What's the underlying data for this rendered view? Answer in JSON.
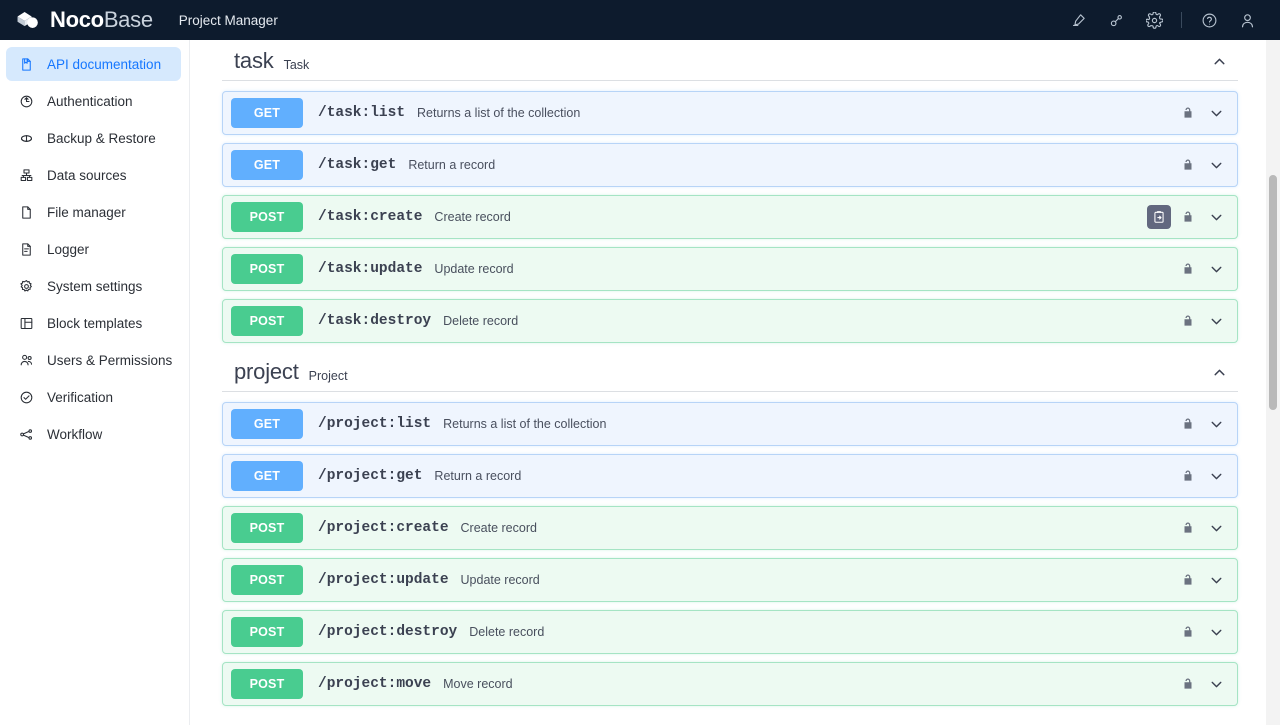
{
  "header": {
    "brand_primary": "Noco",
    "brand_secondary": "Base",
    "app_title": "Project Manager",
    "icons": [
      {
        "name": "highlighter-icon",
        "label": "Highlighter"
      },
      {
        "name": "plugin-icon",
        "label": "Plugin manager"
      },
      {
        "name": "gear-icon",
        "label": "Settings"
      },
      {
        "name": "help-circle-icon",
        "label": "Help"
      },
      {
        "name": "user-avatar-icon",
        "label": "Account"
      }
    ],
    "background_color": "#0d1b2d"
  },
  "sidebar": {
    "active_index": 0,
    "active_color": "#1677ff",
    "active_bg": "#d6e9fd",
    "items": [
      {
        "label": "API documentation",
        "icon": "api-doc-icon"
      },
      {
        "label": "Authentication",
        "icon": "authentication-icon"
      },
      {
        "label": "Backup & Restore",
        "icon": "backup-restore-icon"
      },
      {
        "label": "Data sources",
        "icon": "data-sources-icon"
      },
      {
        "label": "File manager",
        "icon": "file-manager-icon"
      },
      {
        "label": "Logger",
        "icon": "logger-icon"
      },
      {
        "label": "System settings",
        "icon": "system-settings-icon"
      },
      {
        "label": "Block templates",
        "icon": "block-templates-icon"
      },
      {
        "label": "Users & Permissions",
        "icon": "users-permissions-icon"
      },
      {
        "label": "Verification",
        "icon": "verification-icon"
      },
      {
        "label": "Workflow",
        "icon": "workflow-icon"
      }
    ]
  },
  "main": {
    "verb_colors": {
      "GET": "#61affe",
      "POST": "#49cc90"
    },
    "sections": [
      {
        "name": "task",
        "title": "Task",
        "collapsed": false,
        "toggle_icon": "chevron-up-icon",
        "operations": [
          {
            "verb": "GET",
            "path": "/task:list",
            "desc": "Returns a list of the collection",
            "lock": "unlocked-icon",
            "chevron": "chevron-down-icon",
            "copy": false
          },
          {
            "verb": "GET",
            "path": "/task:get",
            "desc": "Return a record",
            "lock": "unlocked-icon",
            "chevron": "chevron-down-icon",
            "copy": false
          },
          {
            "verb": "POST",
            "path": "/task:create",
            "desc": "Create record",
            "lock": "unlocked-icon",
            "chevron": "chevron-down-icon",
            "copy": true
          },
          {
            "verb": "POST",
            "path": "/task:update",
            "desc": "Update record",
            "lock": "unlocked-icon",
            "chevron": "chevron-down-icon",
            "copy": false
          },
          {
            "verb": "POST",
            "path": "/task:destroy",
            "desc": "Delete record",
            "lock": "unlocked-icon",
            "chevron": "chevron-down-icon",
            "copy": false
          }
        ]
      },
      {
        "name": "project",
        "title": "Project",
        "collapsed": false,
        "toggle_icon": "chevron-up-icon",
        "operations": [
          {
            "verb": "GET",
            "path": "/project:list",
            "desc": "Returns a list of the collection",
            "lock": "unlocked-icon",
            "chevron": "chevron-down-icon",
            "copy": false
          },
          {
            "verb": "GET",
            "path": "/project:get",
            "desc": "Return a record",
            "lock": "unlocked-icon",
            "chevron": "chevron-down-icon",
            "copy": false
          },
          {
            "verb": "POST",
            "path": "/project:create",
            "desc": "Create record",
            "lock": "unlocked-icon",
            "chevron": "chevron-down-icon",
            "copy": false
          },
          {
            "verb": "POST",
            "path": "/project:update",
            "desc": "Update record",
            "lock": "unlocked-icon",
            "chevron": "chevron-down-icon",
            "copy": false
          },
          {
            "verb": "POST",
            "path": "/project:destroy",
            "desc": "Delete record",
            "lock": "unlocked-icon",
            "chevron": "chevron-down-icon",
            "copy": false
          },
          {
            "verb": "POST",
            "path": "/project:move",
            "desc": "Move record",
            "lock": "unlocked-icon",
            "chevron": "chevron-down-icon",
            "copy": false
          }
        ]
      }
    ]
  },
  "scrollbar": {
    "name": "vertical-scrollbar",
    "thumb_color": "#b9b9b9"
  }
}
